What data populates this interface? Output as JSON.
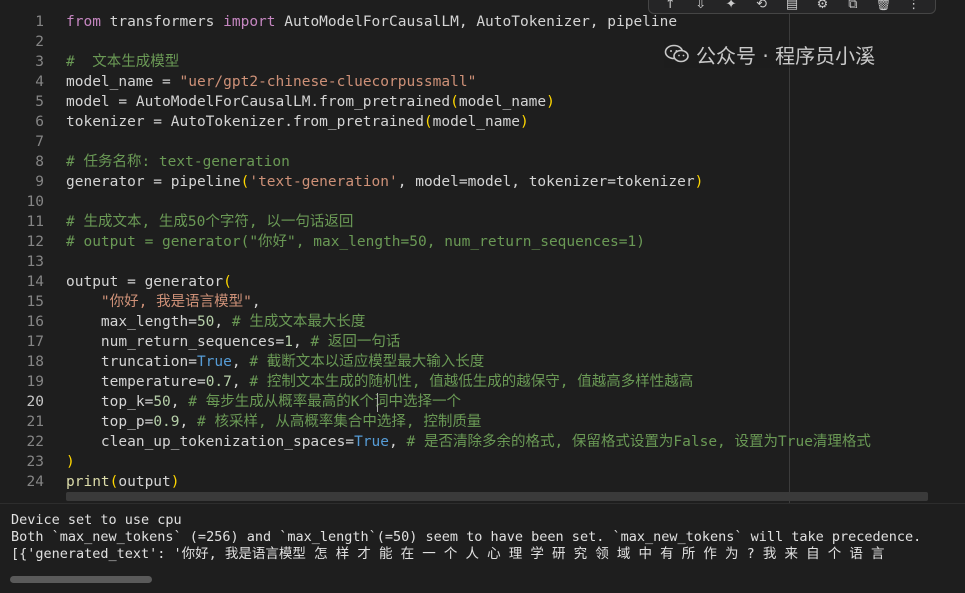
{
  "toolbar": {
    "icons": [
      "pin-icon",
      "add-below-icon",
      "sparkle-icon",
      "link-icon",
      "comment-icon",
      "gear-icon",
      "split-icon",
      "delete-icon",
      "more-icon"
    ],
    "glyphs": [
      "↑",
      "⇩",
      "✦",
      "⟲",
      "▤",
      "⚙",
      "⧉",
      "🗑",
      "⋮"
    ]
  },
  "editor": {
    "active_line": 20,
    "lines": [
      {
        "n": "1",
        "tokens": [
          [
            "kw",
            "from"
          ],
          [
            "",
            ""
          ],
          [
            "plain",
            " transformers "
          ],
          [
            "kw",
            "import"
          ],
          [
            "plain",
            " AutoModelForCausalLM, AutoTokenizer, pipeline"
          ]
        ]
      },
      {
        "n": "2",
        "tokens": []
      },
      {
        "n": "3",
        "tokens": [
          [
            "cm",
            "#  文本生成模型"
          ]
        ]
      },
      {
        "n": "4",
        "tokens": [
          [
            "plain",
            "model_name = "
          ],
          [
            "str",
            "\"uer/gpt2-chinese-cluecorpussmall\""
          ]
        ]
      },
      {
        "n": "5",
        "tokens": [
          [
            "plain",
            "model = AutoModelForCausalLM.from_pretrained"
          ],
          [
            "br",
            "("
          ],
          [
            "plain",
            "model_name"
          ],
          [
            "br",
            ")"
          ]
        ]
      },
      {
        "n": "6",
        "tokens": [
          [
            "plain",
            "tokenizer = AutoTokenizer.from_pretrained"
          ],
          [
            "br",
            "("
          ],
          [
            "plain",
            "model_name"
          ],
          [
            "br",
            ")"
          ]
        ]
      },
      {
        "n": "7",
        "tokens": []
      },
      {
        "n": "8",
        "tokens": [
          [
            "cm",
            "# 任务名称: text-generation"
          ]
        ]
      },
      {
        "n": "9",
        "tokens": [
          [
            "plain",
            "generator = pipeline"
          ],
          [
            "br",
            "("
          ],
          [
            "str",
            "'text-generation'"
          ],
          [
            "plain",
            ", model=model, tokenizer=tokenizer"
          ],
          [
            "br",
            ")"
          ]
        ]
      },
      {
        "n": "10",
        "tokens": []
      },
      {
        "n": "11",
        "tokens": [
          [
            "cm",
            "# 生成文本, 生成50个字符, 以一句话返回"
          ]
        ]
      },
      {
        "n": "12",
        "tokens": [
          [
            "cm",
            "# output = generator(\"你好\", max_length=50, num_return_sequences=1)"
          ]
        ]
      },
      {
        "n": "13",
        "tokens": []
      },
      {
        "n": "14",
        "tokens": [
          [
            "plain",
            "output = generator"
          ],
          [
            "br",
            "("
          ]
        ]
      },
      {
        "n": "15",
        "tokens": [
          [
            "plain",
            "    "
          ],
          [
            "str",
            "\"你好, 我是语言模型\""
          ],
          [
            "plain",
            ","
          ]
        ]
      },
      {
        "n": "16",
        "tokens": [
          [
            "plain",
            "    max_length="
          ],
          [
            "num",
            "50"
          ],
          [
            "plain",
            ", "
          ],
          [
            "cm",
            "# 生成文本最大长度"
          ]
        ]
      },
      {
        "n": "17",
        "tokens": [
          [
            "plain",
            "    num_return_sequences="
          ],
          [
            "num",
            "1"
          ],
          [
            "plain",
            ", "
          ],
          [
            "cm",
            "# 返回一句话"
          ]
        ]
      },
      {
        "n": "18",
        "tokens": [
          [
            "plain",
            "    truncation="
          ],
          [
            "cst",
            "True"
          ],
          [
            "plain",
            ", "
          ],
          [
            "cm",
            "# 截断文本以适应模型最大输入长度"
          ]
        ]
      },
      {
        "n": "19",
        "tokens": [
          [
            "plain",
            "    temperature="
          ],
          [
            "num",
            "0.7"
          ],
          [
            "plain",
            ", "
          ],
          [
            "cm",
            "# 控制文本生成的随机性, 值越低生成的越保守, 值越高多样性越高"
          ]
        ]
      },
      {
        "n": "20",
        "tokens": [
          [
            "plain",
            "    top_k="
          ],
          [
            "num",
            "50"
          ],
          [
            "plain",
            ", "
          ],
          [
            "cm",
            "# 每步生成从概率最高的K个词中选择一个"
          ]
        ]
      },
      {
        "n": "21",
        "tokens": [
          [
            "plain",
            "    top_p="
          ],
          [
            "num",
            "0.9"
          ],
          [
            "plain",
            ", "
          ],
          [
            "cm",
            "# 核采样, 从高概率集合中选择, 控制质量"
          ]
        ]
      },
      {
        "n": "22",
        "tokens": [
          [
            "plain",
            "    clean_up_tokenization_spaces="
          ],
          [
            "cst",
            "True"
          ],
          [
            "plain",
            ", "
          ],
          [
            "cm",
            "# 是否清除多余的格式, 保留格式设置为False, 设置为True清理格式"
          ]
        ]
      },
      {
        "n": "23",
        "tokens": [
          [
            "br",
            ")"
          ]
        ]
      },
      {
        "n": "24",
        "tokens": [
          [
            "fn",
            "print"
          ],
          [
            "br",
            "("
          ],
          [
            "plain",
            "output"
          ],
          [
            "br",
            ")"
          ]
        ]
      }
    ]
  },
  "output": {
    "lines": [
      "Device set to use cpu",
      "Both `max_new_tokens` (=256) and `max_length`(=50) seem to have been set. `max_new_tokens` will take precedence.",
      "[{'generated_text': '你好, 我是语言模型 怎 样 才 能 在 一 个 人 心 理 学 研 究 领 域 中 有 所 作 为 ? 我 来 自 个 语 言"
    ]
  },
  "watermark": {
    "text": "公众号 · 程序员小溪"
  }
}
